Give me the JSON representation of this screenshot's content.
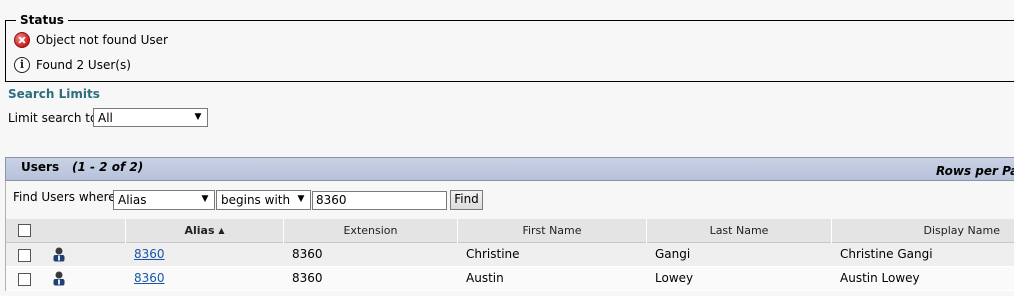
{
  "status": {
    "legend": "Status",
    "messages": [
      {
        "icon": "error-icon",
        "text": "Object not found User"
      },
      {
        "icon": "info-icon",
        "text": "Found 2 User(s)"
      }
    ]
  },
  "search_limits": {
    "heading": "Search Limits",
    "label": "Limit search to",
    "selected": "All"
  },
  "users_panel": {
    "title": "Users",
    "range": "(1 - 2 of 2)",
    "rows_per_page_label": "Rows per Pa"
  },
  "find": {
    "label": "Find Users where",
    "field_selected": "Alias",
    "operator_selected": "begins with",
    "value": "8360",
    "button_label": "Find"
  },
  "table": {
    "columns": [
      "Alias",
      "Extension",
      "First Name",
      "Last Name",
      "Display Name"
    ],
    "sort_column": "Alias",
    "sort_indicator": "▲",
    "rows": [
      {
        "alias": "8360",
        "extension": "8360",
        "first_name": "Christine",
        "last_name": "Gangi",
        "display_name": "Christine Gangi"
      },
      {
        "alias": "8360",
        "extension": "8360",
        "first_name": "Austin",
        "last_name": "Lowey",
        "display_name": "Austin Lowey"
      }
    ]
  },
  "colors": {
    "accent_heading": "#2d6e7e",
    "link": "#1a56a8",
    "header_bar": "#c2cbe0"
  }
}
